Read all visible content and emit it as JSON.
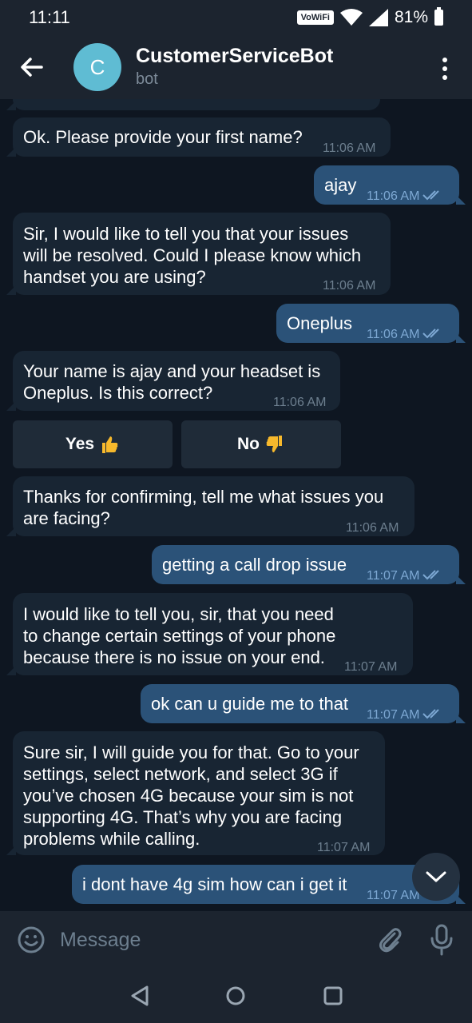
{
  "status_bar": {
    "time": "11:11",
    "vowifi": "VoWiFi",
    "battery": "81%"
  },
  "header": {
    "avatar_letter": "C",
    "title": "CustomerServiceBot",
    "subtitle": "bot"
  },
  "messages": [
    {
      "dir": "in",
      "text": "Ok. Please provide your first name?",
      "time": "11:06 AM"
    },
    {
      "dir": "out",
      "text": "ajay",
      "time": "11:06 AM"
    },
    {
      "dir": "in",
      "text": "Sir, I would like to tell you that your issues\nwill be resolved. Could I please know which\nhandset you are using?",
      "time": "11:06 AM"
    },
    {
      "dir": "out",
      "text": "Oneplus",
      "time": "11:06 AM"
    },
    {
      "dir": "in",
      "text": "Your name is ajay and your headset is\nOneplus. Is this correct?",
      "time": "11:06 AM"
    },
    {
      "dir": "in",
      "text": "Thanks for confirming, tell me what issues you\nare facing?",
      "time": "11:06 AM"
    },
    {
      "dir": "out",
      "text": "getting a call drop issue",
      "time": "11:07 AM"
    },
    {
      "dir": "in",
      "text": "I would like to tell you, sir, that you need\nto change certain settings of your phone\nbecause there is no issue on your end.",
      "time": "11:07 AM"
    },
    {
      "dir": "out",
      "text": "ok can u guide me to that",
      "time": "11:07 AM"
    },
    {
      "dir": "in",
      "text": "Sure sir, I will guide you for that. Go to your\nsettings, select network, and select 3G if\nyou’ve chosen 4G because your sim is not\nsupporting 4G. That’s why you are facing\nproblems while calling.",
      "time": "11:07 AM"
    },
    {
      "dir": "out",
      "text": "i dont have 4g sim how can i get it",
      "time": "11:07 AM"
    }
  ],
  "keyboard": {
    "yes_label": "Yes",
    "no_label": "No",
    "yes_icon": "thumbs-up-icon",
    "no_icon": "thumbs-down-icon"
  },
  "input": {
    "placeholder": "Message"
  },
  "colors": {
    "background": "#0e1621",
    "bar": "#1c242f",
    "incoming": "#182533",
    "outgoing": "#2b5278",
    "accent": "#5fbcd3"
  }
}
